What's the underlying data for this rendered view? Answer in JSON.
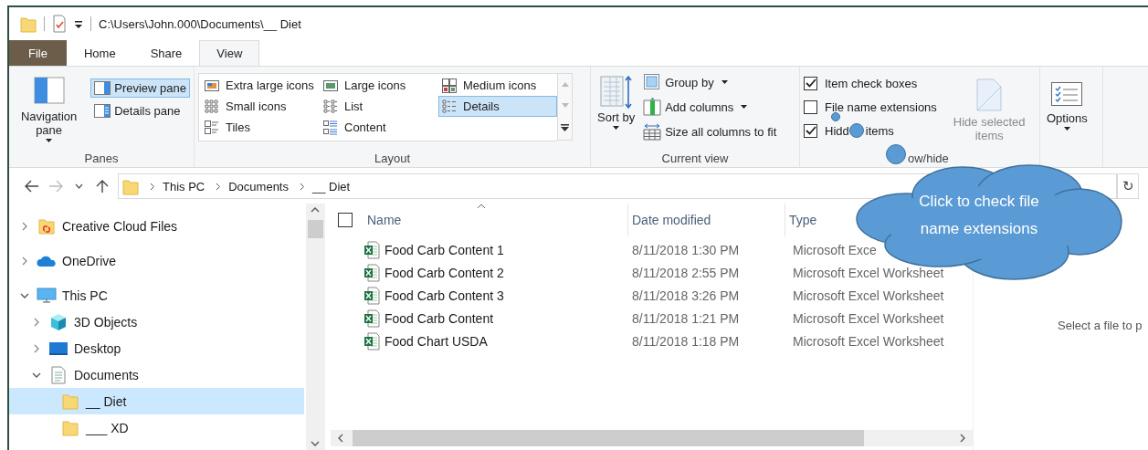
{
  "title_bar": {
    "path": "C:\\Users\\John.000\\Documents\\__ Diet"
  },
  "ribbon_tabs": [
    {
      "label": "File",
      "kind": "file",
      "selected": false
    },
    {
      "label": "Home",
      "kind": "tab",
      "selected": false
    },
    {
      "label": "Share",
      "kind": "tab",
      "selected": false
    },
    {
      "label": "View",
      "kind": "tab",
      "selected": true
    }
  ],
  "panes_group": {
    "label": "Panes",
    "navigation_pane": "Navigation pane",
    "buttons": [
      {
        "label": "Preview pane",
        "selected": true
      },
      {
        "label": "Details pane",
        "selected": false
      }
    ]
  },
  "layout_group": {
    "label": "Layout",
    "options": [
      {
        "label": "Extra large icons",
        "selected": false
      },
      {
        "label": "Large icons",
        "selected": false
      },
      {
        "label": "Medium icons",
        "selected": false
      },
      {
        "label": "Small icons",
        "selected": false
      },
      {
        "label": "List",
        "selected": false
      },
      {
        "label": "Details",
        "selected": true
      },
      {
        "label": "Tiles",
        "selected": false
      },
      {
        "label": "Content",
        "selected": false
      }
    ]
  },
  "current_view_group": {
    "label": "Current view",
    "sort_by": "Sort by",
    "commands": [
      {
        "label": "Group by",
        "dropdown": true
      },
      {
        "label": "Add columns",
        "dropdown": true
      },
      {
        "label": "Size all columns to fit",
        "dropdown": false
      }
    ]
  },
  "show_hide_group": {
    "label": "ow/hide",
    "checkboxes": [
      {
        "label": "Item check boxes",
        "checked": true
      },
      {
        "label": "File name extensions",
        "checked": false
      },
      {
        "label": "Hidd",
        "label_after_bubble": "items",
        "checked": true
      }
    ],
    "hide_selected": {
      "label": "Hide selected items",
      "disabled": true
    }
  },
  "options_button": {
    "label": "Options"
  },
  "address_bar": {
    "crumbs": [
      "This PC",
      "Documents",
      "__ Diet"
    ],
    "refresh": "↻"
  },
  "navigation_tree": [
    {
      "label": "Creative Cloud Files",
      "kind": "cc",
      "expanded": false
    },
    {
      "label": "OneDrive",
      "kind": "cloud",
      "expanded": false
    },
    {
      "label": "This PC",
      "kind": "pc",
      "expanded": true,
      "children": [
        {
          "label": "3D Objects",
          "kind": "cube",
          "expanded": false
        },
        {
          "label": "Desktop",
          "kind": "desktop",
          "expanded": false
        },
        {
          "label": "Documents",
          "kind": "doc",
          "expanded": true,
          "children": [
            {
              "label": "__ Diet",
              "kind": "folder",
              "selected": true
            },
            {
              "label": "___ XD",
              "kind": "folder",
              "selected": false
            }
          ]
        }
      ]
    }
  ],
  "file_list": {
    "select_all": {
      "checked": false
    },
    "columns": [
      "Name",
      "Date modified",
      "Type"
    ],
    "rows": [
      {
        "name": "Food Carb Content 1",
        "date": "8/11/2018 1:30 PM",
        "type": "Microsoft Exce"
      },
      {
        "name": "Food Carb Content 2",
        "date": "8/11/2018 2:55 PM",
        "type": "Microsoft Excel Worksheet"
      },
      {
        "name": "Food Carb Content 3",
        "date": "8/11/2018 3:26 PM",
        "type": "Microsoft Excel Worksheet"
      },
      {
        "name": "Food Carb Content",
        "date": "8/11/2018 1:21 PM",
        "type": "Microsoft Excel Worksheet"
      },
      {
        "name": "Food Chart USDA",
        "date": "8/11/2018 1:18 PM",
        "type": "Microsoft Excel Worksheet"
      }
    ]
  },
  "preview_pane": {
    "message": "Select a file to p"
  },
  "callout": {
    "text": "Click to check file name extensions"
  }
}
